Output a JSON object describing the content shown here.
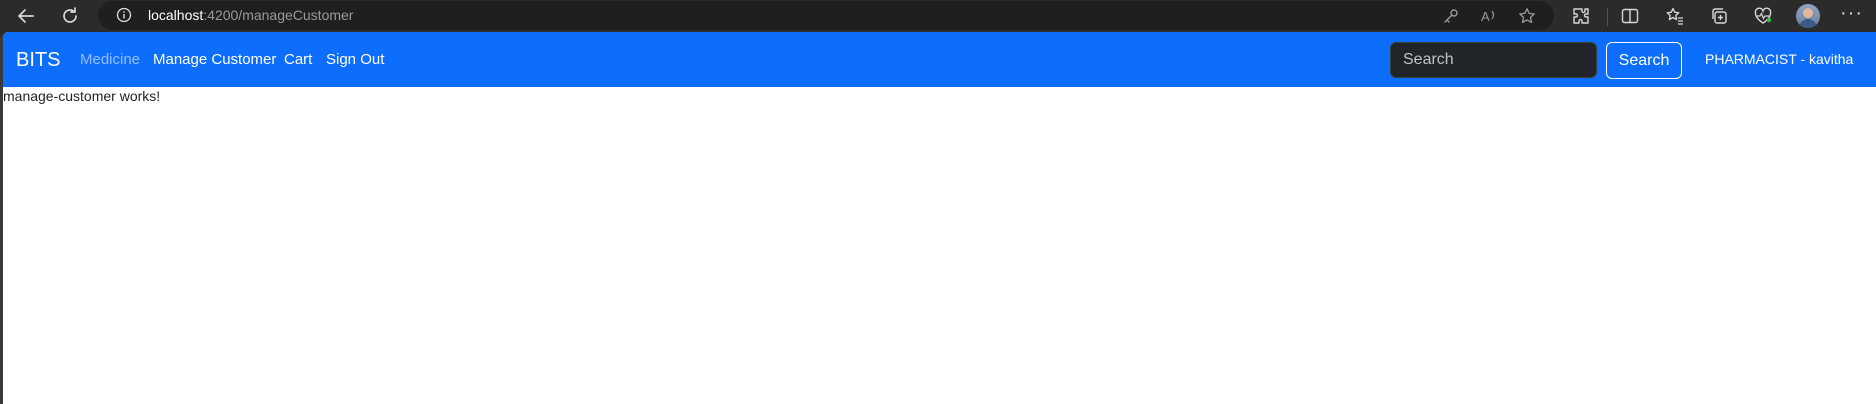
{
  "browser": {
    "url_host": "localhost",
    "url_rest": ":4200/manageCustomer",
    "icons": [
      "back-arrow-icon",
      "refresh-icon",
      "info-icon",
      "key-icon",
      "read-aloud-icon",
      "favorite-star-icon",
      "extensions-icon",
      "split-screen-icon",
      "favorites-icon",
      "collections-icon",
      "browser-essentials-icon",
      "profile-avatar",
      "more-icon"
    ]
  },
  "navbar": {
    "brand": "BITS",
    "links": [
      "Medicine",
      "Manage Customer",
      "Cart",
      "Sign Out"
    ],
    "search_placeholder": "Search",
    "search_button": "Search",
    "user": "PHARMACIST - kavitha",
    "color": "#0d6efd"
  },
  "content": {
    "text": "manage-customer works!"
  }
}
